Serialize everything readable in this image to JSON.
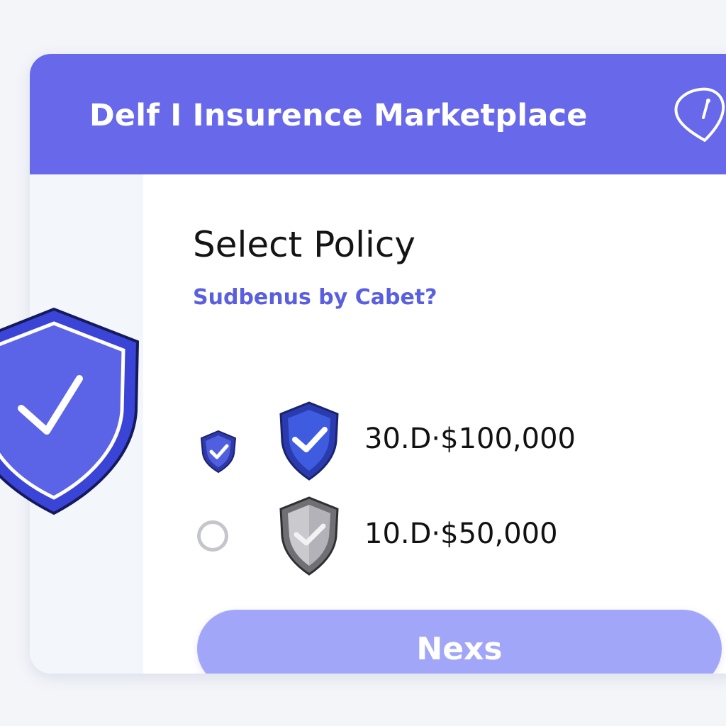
{
  "header": {
    "title": "Delf I Insurence Marketplace",
    "icon": "shield-settings-icon"
  },
  "main": {
    "title": "Select Policy",
    "subtitle": "Sudbenus by Cabet?"
  },
  "options": [
    {
      "label": "30.D·$100,000",
      "selected": true,
      "icon": "blue-shield-check-icon"
    },
    {
      "label": "10.D·$50,000",
      "selected": false,
      "icon": "gray-shield-check-icon"
    }
  ],
  "next_button": {
    "label": "Nexs"
  },
  "colors": {
    "header": "#6768ea",
    "accent": "#5a5fe0",
    "button": "#a1a6f9",
    "shield_blue": "#3f5be0",
    "shield_gray": "#a8a8ad"
  }
}
